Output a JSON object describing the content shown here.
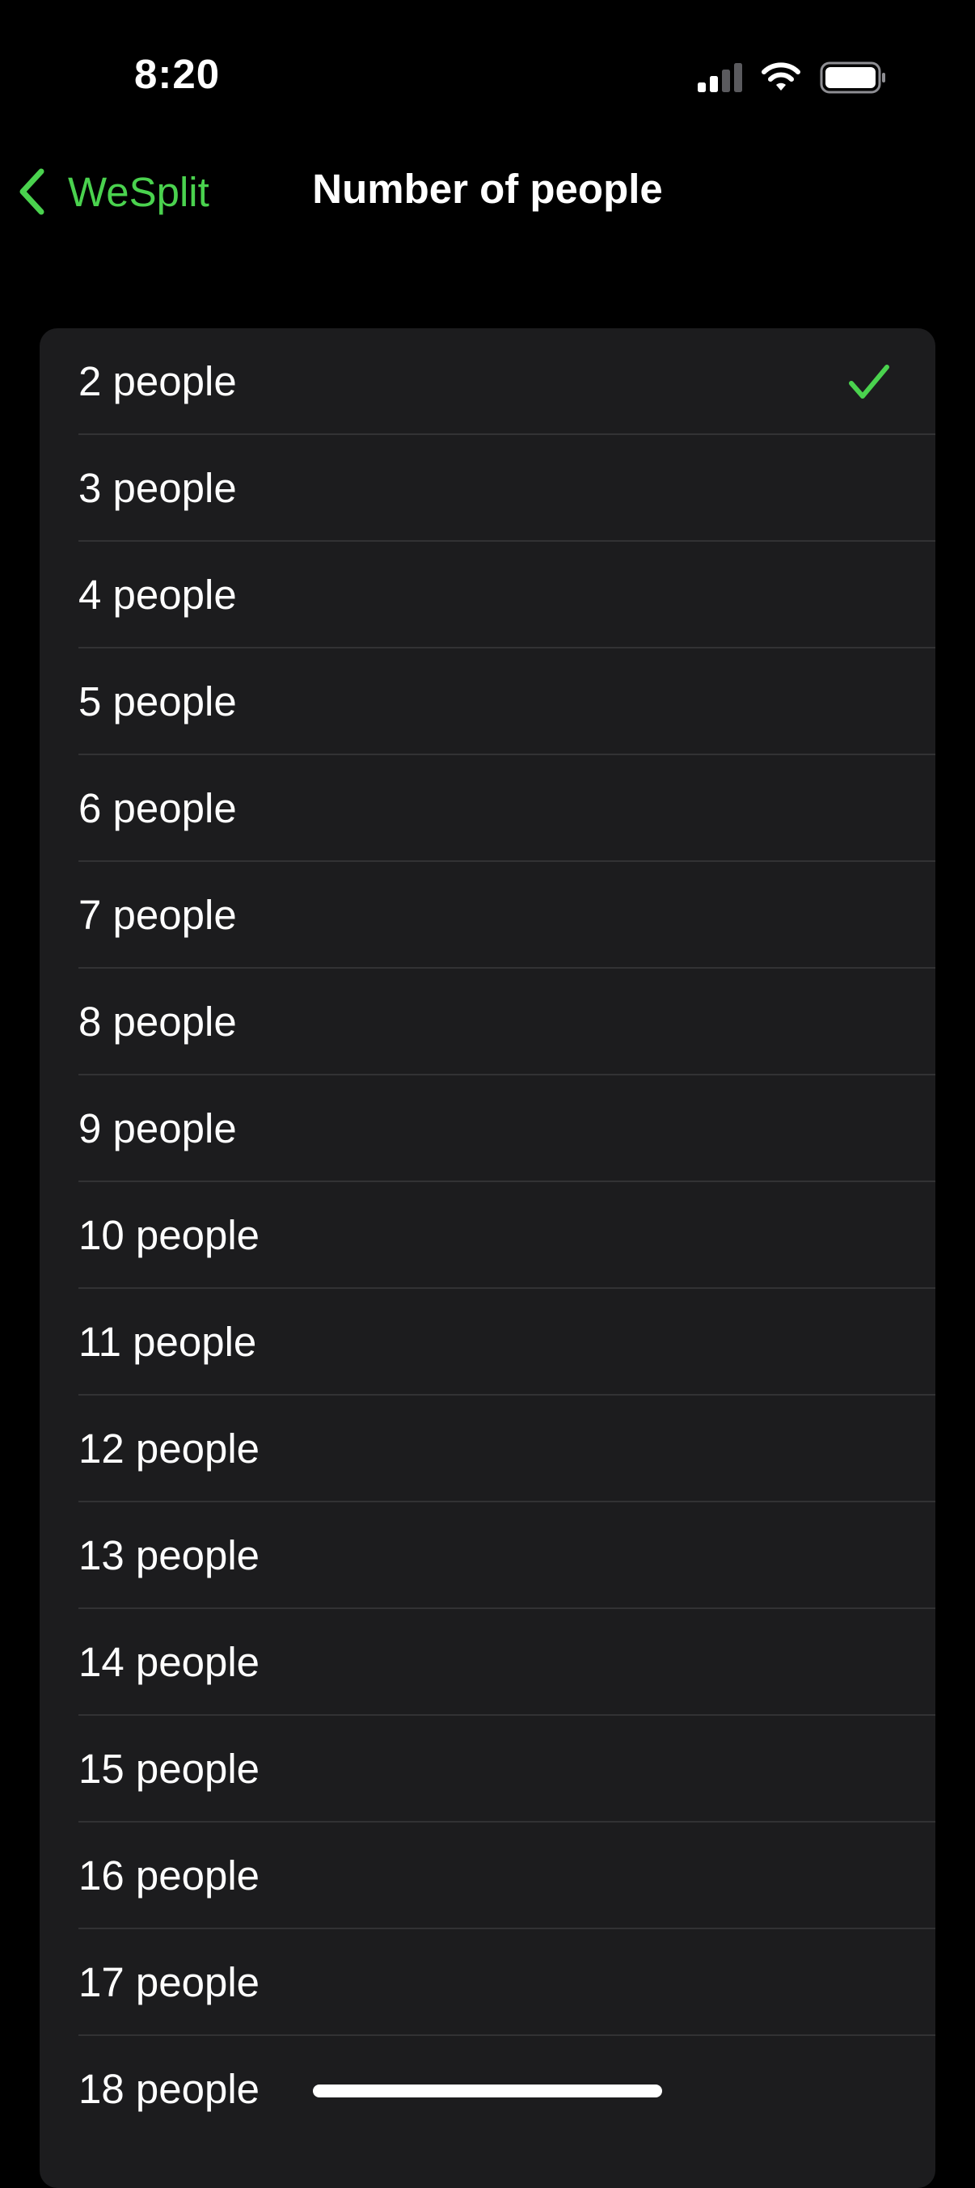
{
  "status_bar": {
    "time": "8:20"
  },
  "nav": {
    "back_label": "WeSplit",
    "title": "Number of people"
  },
  "list": {
    "selected_index": 0,
    "items": [
      "2 people",
      "3 people",
      "4 people",
      "5 people",
      "6 people",
      "7 people",
      "8 people",
      "9 people",
      "10 people",
      "11 people",
      "12 people",
      "13 people",
      "14 people",
      "15 people",
      "16 people",
      "17 people",
      "18 people"
    ]
  },
  "colors": {
    "accent": "#4ad24e",
    "background": "#000000",
    "card": "#1c1c1e",
    "divider": "#323234"
  },
  "icons": {
    "back": "chevron-left-icon",
    "selected": "checkmark-icon",
    "signal": "cellular-signal-icon",
    "wifi": "wifi-icon",
    "battery": "battery-icon"
  }
}
